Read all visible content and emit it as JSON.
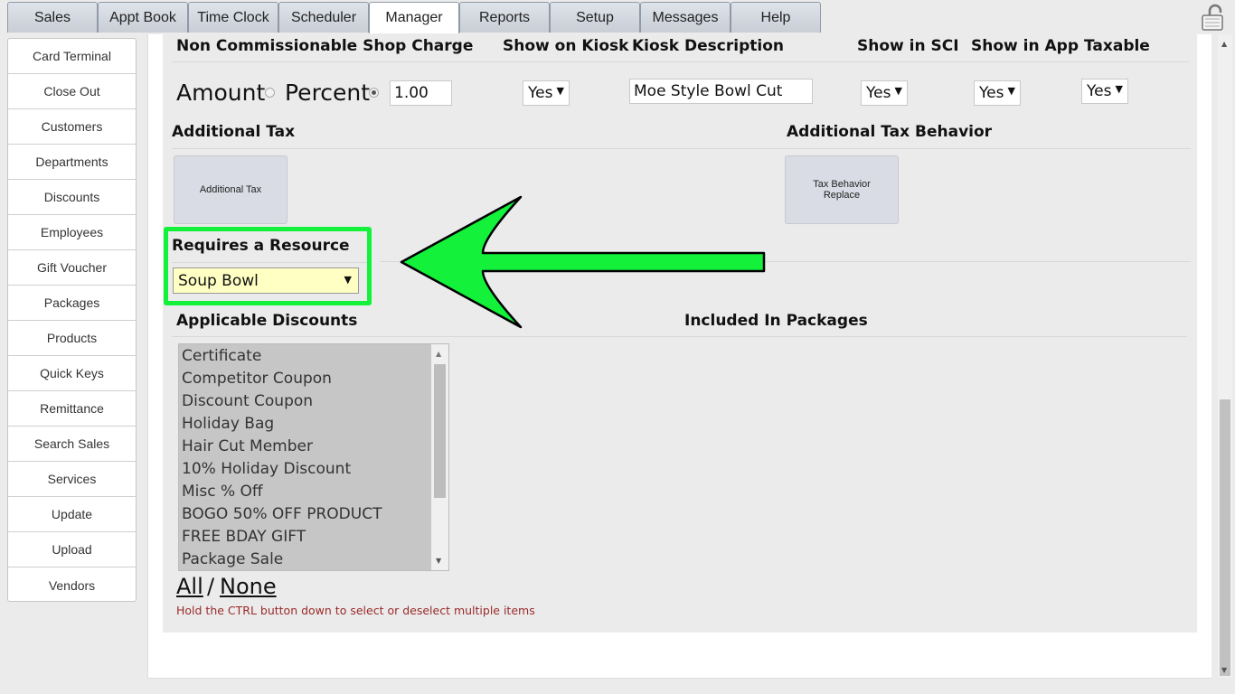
{
  "tabs": [
    "Sales",
    "Appt Book",
    "Time Clock",
    "Scheduler",
    "Manager",
    "Reports",
    "Setup",
    "Messages",
    "Help"
  ],
  "active_tab": "Manager",
  "sidebar": {
    "items": [
      "Card Terminal",
      "Close Out",
      "Customers",
      "Departments",
      "Discounts",
      "Employees",
      "Gift Voucher",
      "Packages",
      "Products",
      "Quick Keys",
      "Remittance",
      "Search Sales",
      "Services",
      "Update",
      "Upload",
      "Vendors"
    ]
  },
  "headers": {
    "non_commissionable": "Non Commissionable Shop Charge",
    "show_on_kiosk": "Show on Kiosk",
    "kiosk_description": "Kiosk Description",
    "show_in_sci": "Show in SCI",
    "show_in_app": "Show in App",
    "taxable": "Taxable",
    "additional_tax": "Additional Tax",
    "additional_tax_behavior": "Additional Tax Behavior",
    "requires_resource": "Requires a Resource",
    "applicable_discounts": "Applicable Discounts",
    "included_in_packages": "Included In Packages"
  },
  "charge": {
    "amount_label": "Amount",
    "percent_label": "Percent",
    "selected": "Percent",
    "value": "1.00"
  },
  "selects": {
    "show_on_kiosk": "Yes",
    "show_in_sci": "Yes",
    "show_in_app": "Yes",
    "taxable": "Yes"
  },
  "kiosk_description_value": "Moe Style Bowl Cut",
  "buttons": {
    "additional_tax": "Additional Tax",
    "tax_behavior_line1": "Tax Behavior",
    "tax_behavior_line2": "Replace"
  },
  "resource_value": "Soup Bowl",
  "discounts": [
    "Certificate",
    "Competitor Coupon",
    "Discount Coupon",
    "Holiday Bag",
    "Hair Cut Member",
    "10% Holiday Discount",
    "Misc % Off",
    "BOGO 50% OFF PRODUCT",
    "FREE BDAY GIFT",
    "Package Sale"
  ],
  "links": {
    "all": "All",
    "separator": "/",
    "none": "None"
  },
  "hint": "Hold the CTRL button down to select or deselect multiple items",
  "colors": {
    "highlight": "#13f13b",
    "hint_text": "#9a2a2a",
    "resource_bg": "#ffffc4"
  },
  "icons": {
    "lock": "unlocked-padlock-icon",
    "dropdown": "caret-down-icon"
  }
}
